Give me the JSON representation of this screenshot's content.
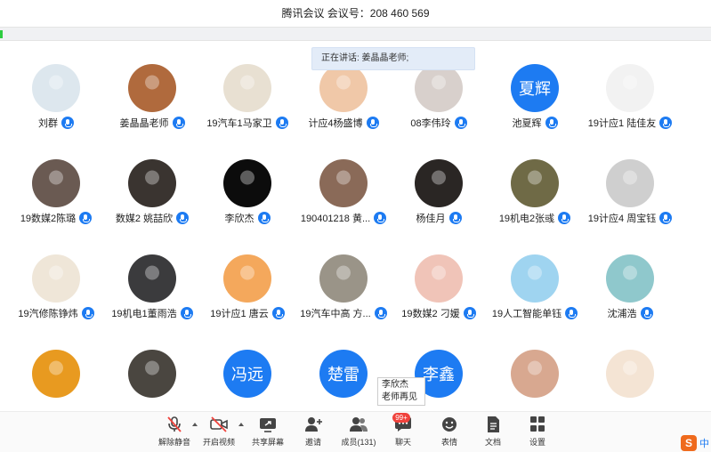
{
  "window": {
    "title": "腾讯会议 会议号：208 460 569"
  },
  "speaking_banner": "正在讲话: 姜晶晶老师;",
  "participants": [
    {
      "name": "刘群",
      "avatar": "image",
      "avatar_color": "#dde7ee"
    },
    {
      "name": "姜晶晶老师",
      "avatar": "image",
      "avatar_color": "#b06a3d",
      "host": true
    },
    {
      "name": "19汽车1马家卫",
      "avatar": "image",
      "avatar_color": "#e8e0d2"
    },
    {
      "name": "计应4杨盛博",
      "avatar": "image",
      "avatar_color": "#f0c8a8"
    },
    {
      "name": "08李伟玲",
      "avatar": "image",
      "avatar_color": "#d8d0cc"
    },
    {
      "name": "池夏辉",
      "avatar": "text",
      "avatar_text": "夏辉"
    },
    {
      "name": "19计应1 陆佳友",
      "avatar": "image",
      "avatar_color": "#f2f2f2"
    },
    {
      "name": "19数媒2陈璐",
      "avatar": "image",
      "avatar_color": "#6a5a52"
    },
    {
      "name": "数媒2 姚喆欣",
      "avatar": "image",
      "avatar_color": "#3a3430"
    },
    {
      "name": "李欣杰",
      "avatar": "image",
      "avatar_color": "#0c0c0c"
    },
    {
      "name": "190401218 黄...",
      "avatar": "image",
      "avatar_color": "#8a6a58"
    },
    {
      "name": "杨佳月",
      "avatar": "image",
      "avatar_color": "#2a2624"
    },
    {
      "name": "19机电2张彧",
      "avatar": "image",
      "avatar_color": "#6f6a46"
    },
    {
      "name": "19计应4 周宝钰",
      "avatar": "image",
      "avatar_color": "#cfcfcf"
    },
    {
      "name": "19汽修陈铮炜",
      "avatar": "image",
      "avatar_color": "#efe6d8"
    },
    {
      "name": "19机电1董雨浩",
      "avatar": "image",
      "avatar_color": "#3b3b3d"
    },
    {
      "name": "19计应1 唐云",
      "avatar": "image",
      "avatar_color": "#f4a85c"
    },
    {
      "name": "19汽车中高 方...",
      "avatar": "image",
      "avatar_color": "#9a9488"
    },
    {
      "name": "19数媒2 刁媛",
      "avatar": "image",
      "avatar_color": "#f0c4b8"
    },
    {
      "name": "19人工智能单钰",
      "avatar": "image",
      "avatar_color": "#9fd4f0"
    },
    {
      "name": "沈浦浩",
      "avatar": "image",
      "avatar_color": "#8fc8cc"
    },
    {
      "name": "",
      "avatar": "image",
      "avatar_color": "#e89a20"
    },
    {
      "name": "",
      "avatar": "image",
      "avatar_color": "#4a4640"
    },
    {
      "name": "",
      "avatar": "text",
      "avatar_text": "冯远"
    },
    {
      "name": "",
      "avatar": "text",
      "avatar_text": "楚雷"
    },
    {
      "name": "",
      "avatar": "text",
      "avatar_text": "李鑫"
    },
    {
      "name": "",
      "avatar": "image",
      "avatar_color": "#d8a890"
    },
    {
      "name": "",
      "avatar": "image",
      "avatar_color": "#f4e4d4"
    }
  ],
  "tooltip": {
    "line1": "李欣杰",
    "line2": "老师再见"
  },
  "toolbar": {
    "unmute": "解除静音",
    "start_video": "开启视频",
    "share_screen": "共享屏幕",
    "invite": "邀请",
    "members": "成员(131)",
    "chat": "聊天",
    "chat_badge": "99+",
    "reactions": "表情",
    "docs": "文档",
    "settings": "设置"
  },
  "ime": {
    "logo": "S",
    "mode": "中"
  },
  "colors": {
    "accent": "#1d7bf2",
    "badge": "#f0423c",
    "speaking_bg": "#e3ecf8"
  }
}
